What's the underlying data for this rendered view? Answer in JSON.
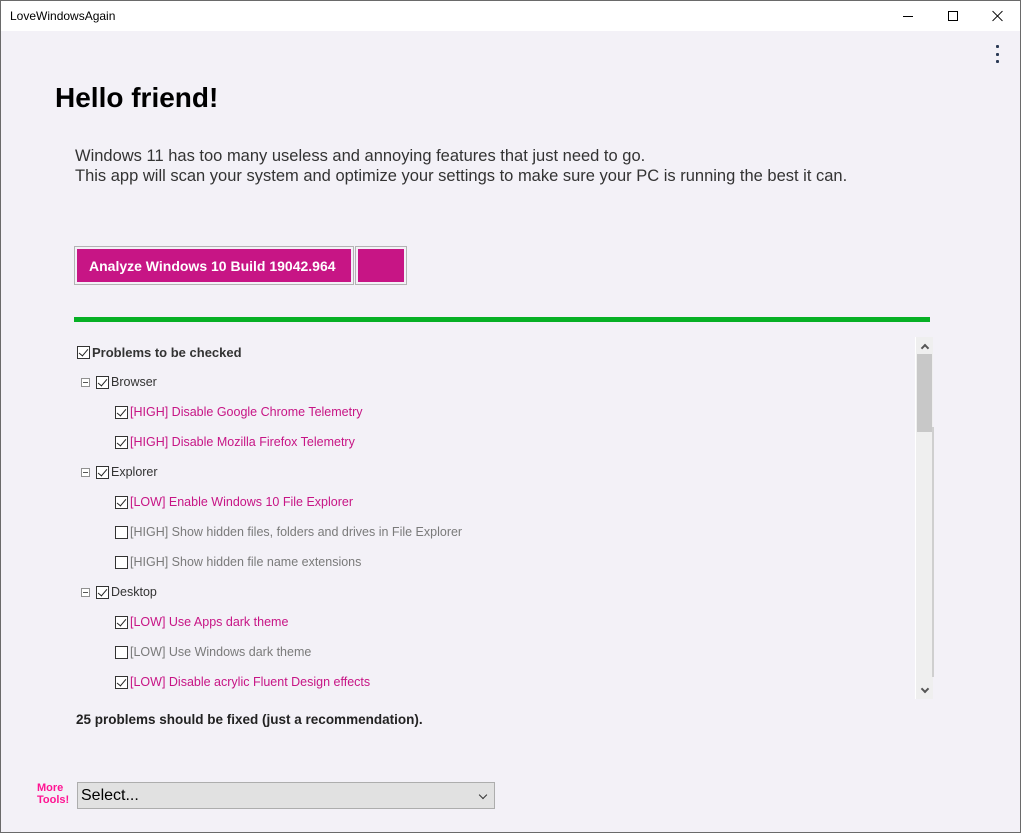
{
  "window": {
    "title": "LoveWindowsAgain",
    "controls": {
      "minimize": "minimize",
      "maximize": "maximize",
      "close": "close"
    }
  },
  "header": {
    "heading": "Hello friend!",
    "intro_line1": "Windows 11 has too many useless and annoying features that just need to go.",
    "intro_line2": "This app will scan your system and optimize your settings to make sure your PC is running the best it can."
  },
  "actions": {
    "analyze_label": "Analyze Windows 10 Build 19042.964",
    "accent_color": "#c71585"
  },
  "progress": {
    "percent": 100,
    "color": "#06b025"
  },
  "tree": {
    "root": {
      "label": "Problems to be checked",
      "checked": true
    },
    "groups": [
      {
        "label": "Browser",
        "checked": true,
        "items": [
          {
            "label": "[HIGH] Disable Google Chrome Telemetry",
            "checked": true
          },
          {
            "label": "[HIGH] Disable Mozilla Firefox Telemetry",
            "checked": true
          }
        ]
      },
      {
        "label": "Explorer",
        "checked": true,
        "items": [
          {
            "label": "[LOW] Enable Windows 10 File Explorer",
            "checked": true
          },
          {
            "label": "[HIGH] Show hidden files, folders and drives in File Explorer",
            "checked": false
          },
          {
            "label": "[HIGH] Show hidden file name extensions",
            "checked": false
          }
        ]
      },
      {
        "label": "Desktop",
        "checked": true,
        "items": [
          {
            "label": "[LOW] Use Apps dark theme",
            "checked": true
          },
          {
            "label": "[LOW] Use Windows dark theme",
            "checked": false
          },
          {
            "label": "[LOW] Disable acrylic Fluent Design effects",
            "checked": true
          }
        ]
      }
    ]
  },
  "summary": "25 problems should be fixed (just a recommendation).",
  "footer": {
    "more_tools_line1": "More",
    "more_tools_line2": "Tools!",
    "select_value": "Select..."
  }
}
